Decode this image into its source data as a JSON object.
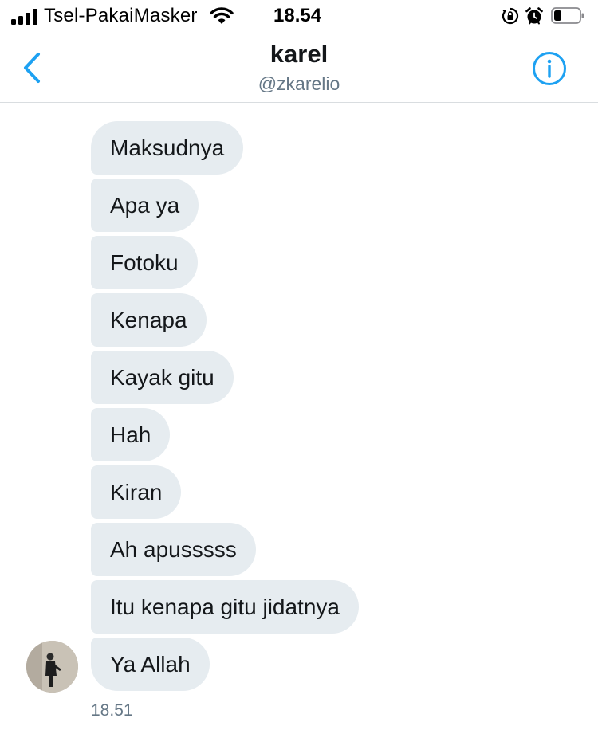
{
  "status_bar": {
    "carrier": "Tsel-PakaiMasker",
    "time": "18.54",
    "icons": [
      "signal-icon",
      "wifi-icon",
      "rotation-lock-icon",
      "alarm-icon",
      "battery-icon"
    ]
  },
  "header": {
    "name": "karel",
    "handle": "@zkarelio",
    "back_icon": "chevron-left-icon",
    "info_icon": "info-icon"
  },
  "conversation": {
    "messages": [
      {
        "text": "Maksudnya"
      },
      {
        "text": "Apa ya"
      },
      {
        "text": "Fotoku"
      },
      {
        "text": "Kenapa"
      },
      {
        "text": "Kayak gitu"
      },
      {
        "text": "Hah"
      },
      {
        "text": "Kiran"
      },
      {
        "text": "Ah apusssss"
      },
      {
        "text": "Itu kenapa gitu jidatnya"
      },
      {
        "text": "Ya Allah"
      }
    ],
    "timestamp": "18.51"
  },
  "colors": {
    "accent": "#1da1f2",
    "bubble_background": "#e6ecf0",
    "secondary_text": "#657786"
  }
}
